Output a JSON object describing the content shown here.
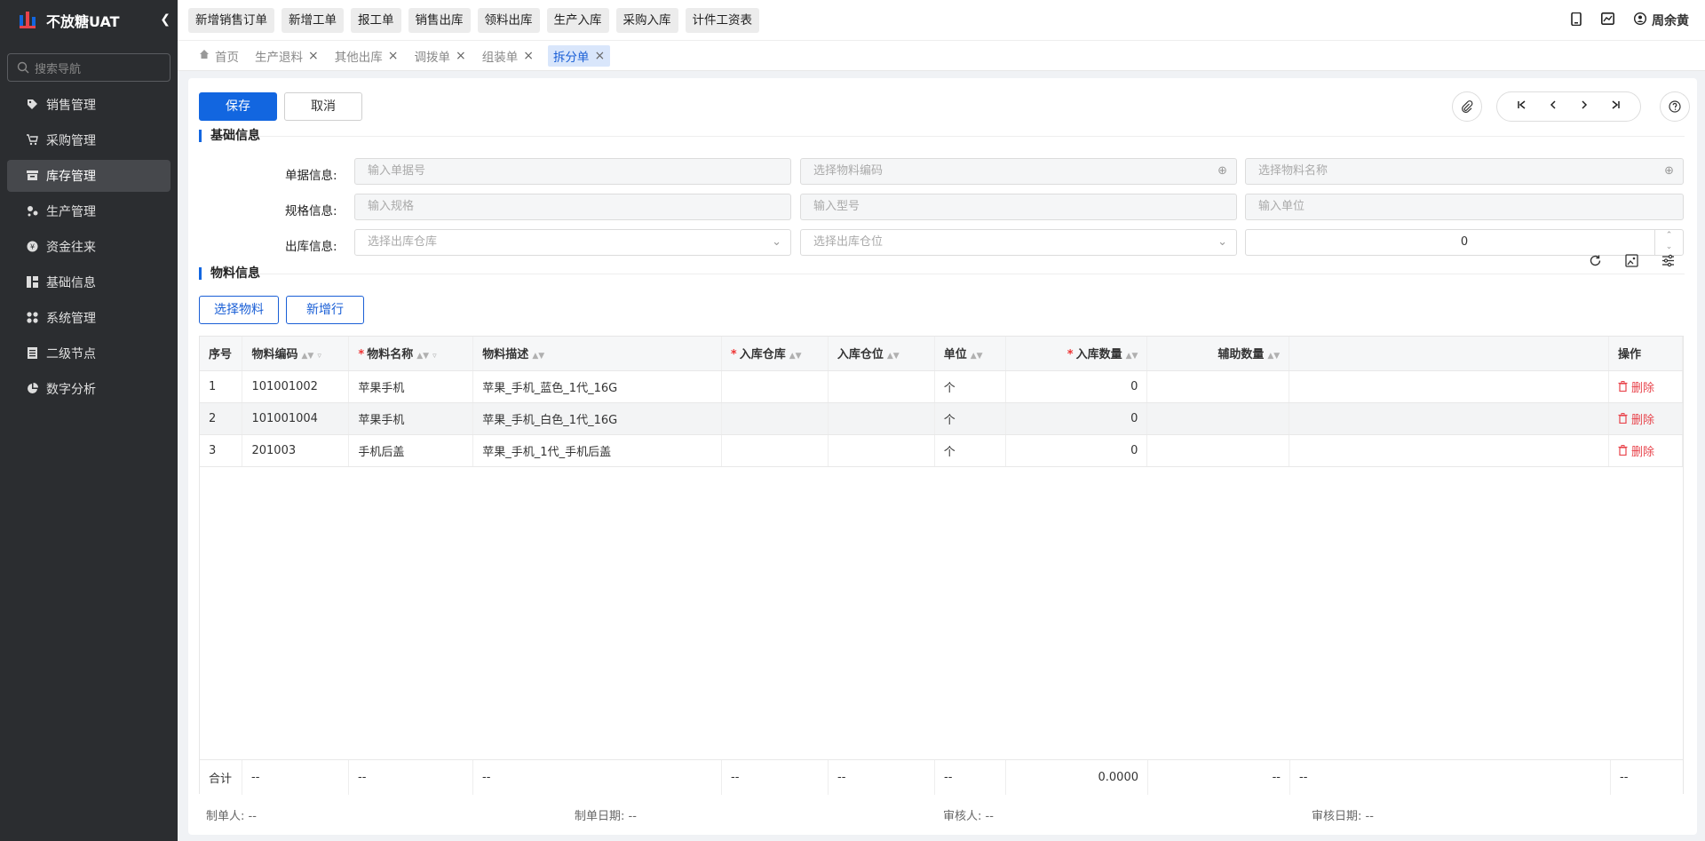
{
  "app": {
    "name": "不放糖UAT"
  },
  "sidebar": {
    "search_placeholder": "搜索导航",
    "items": [
      {
        "label": "销售管理",
        "icon": "tag-icon"
      },
      {
        "label": "采购管理",
        "icon": "cart-icon"
      },
      {
        "label": "库存管理",
        "icon": "inventory-icon"
      },
      {
        "label": "生产管理",
        "icon": "production-icon"
      },
      {
        "label": "资金往来",
        "icon": "money-icon"
      },
      {
        "label": "基础信息",
        "icon": "grid-icon"
      },
      {
        "label": "系统管理",
        "icon": "apps-icon"
      },
      {
        "label": "二级节点",
        "icon": "list-icon"
      },
      {
        "label": "数字分析",
        "icon": "pie-icon"
      }
    ],
    "active_index": 2
  },
  "topbar": {
    "quick_links": [
      "新增销售订单",
      "新增工单",
      "报工单",
      "销售出库",
      "领料出库",
      "生产入库",
      "采购入库",
      "计件工资表"
    ],
    "user": "周余黄"
  },
  "tabs": {
    "items": [
      "首页",
      "生产退料",
      "其他出库",
      "调拨单",
      "组装单",
      "拆分单"
    ],
    "active": "拆分单"
  },
  "toolbar": {
    "save": "保存",
    "cancel": "取消"
  },
  "basic": {
    "title": "基础信息",
    "row1_label": "单据信息:",
    "row2_label": "规格信息:",
    "row3_label": "出库信息:",
    "doc_no_placeholder": "输入单据号",
    "material_code_placeholder": "选择物料编码",
    "material_name_placeholder": "选择物料名称",
    "spec_placeholder": "输入规格",
    "model_placeholder": "输入型号",
    "unit_placeholder": "输入单位",
    "warehouse_placeholder": "选择出库仓库",
    "location_placeholder": "选择出库仓位",
    "quantity": "0"
  },
  "material": {
    "title": "物料信息",
    "select_btn": "选择物料",
    "add_row_btn": "新增行",
    "columns": [
      "序号",
      "物料编码",
      "物料名称",
      "物料描述",
      "入库仓库",
      "入库仓位",
      "单位",
      "入库数量",
      "辅助数量",
      "",
      "操作"
    ],
    "rows": [
      {
        "no": "1",
        "code": "101001002",
        "name": "苹果手机",
        "desc": "苹果_手机_蓝色_1代_16G",
        "unit": "个",
        "qty": "0",
        "action": "删除"
      },
      {
        "no": "2",
        "code": "101001004",
        "name": "苹果手机",
        "desc": "苹果_手机_白色_1代_16G",
        "unit": "个",
        "qty": "0",
        "action": "删除"
      },
      {
        "no": "3",
        "code": "201003",
        "name": "手机后盖",
        "desc": "苹果_手机_1代_手机后盖",
        "unit": "个",
        "qty": "0",
        "action": "删除"
      }
    ],
    "summary": {
      "label": "合计",
      "dash": "--",
      "qty_total": "0.0000"
    }
  },
  "footer": {
    "creator": "制单人: --",
    "create_date": "制单日期: --",
    "reviewer": "审核人: --",
    "review_date": "审核日期: --"
  },
  "colors": {
    "primary": "#1266e0",
    "sidebar": "#2b2d30",
    "danger": "#e8434b"
  }
}
